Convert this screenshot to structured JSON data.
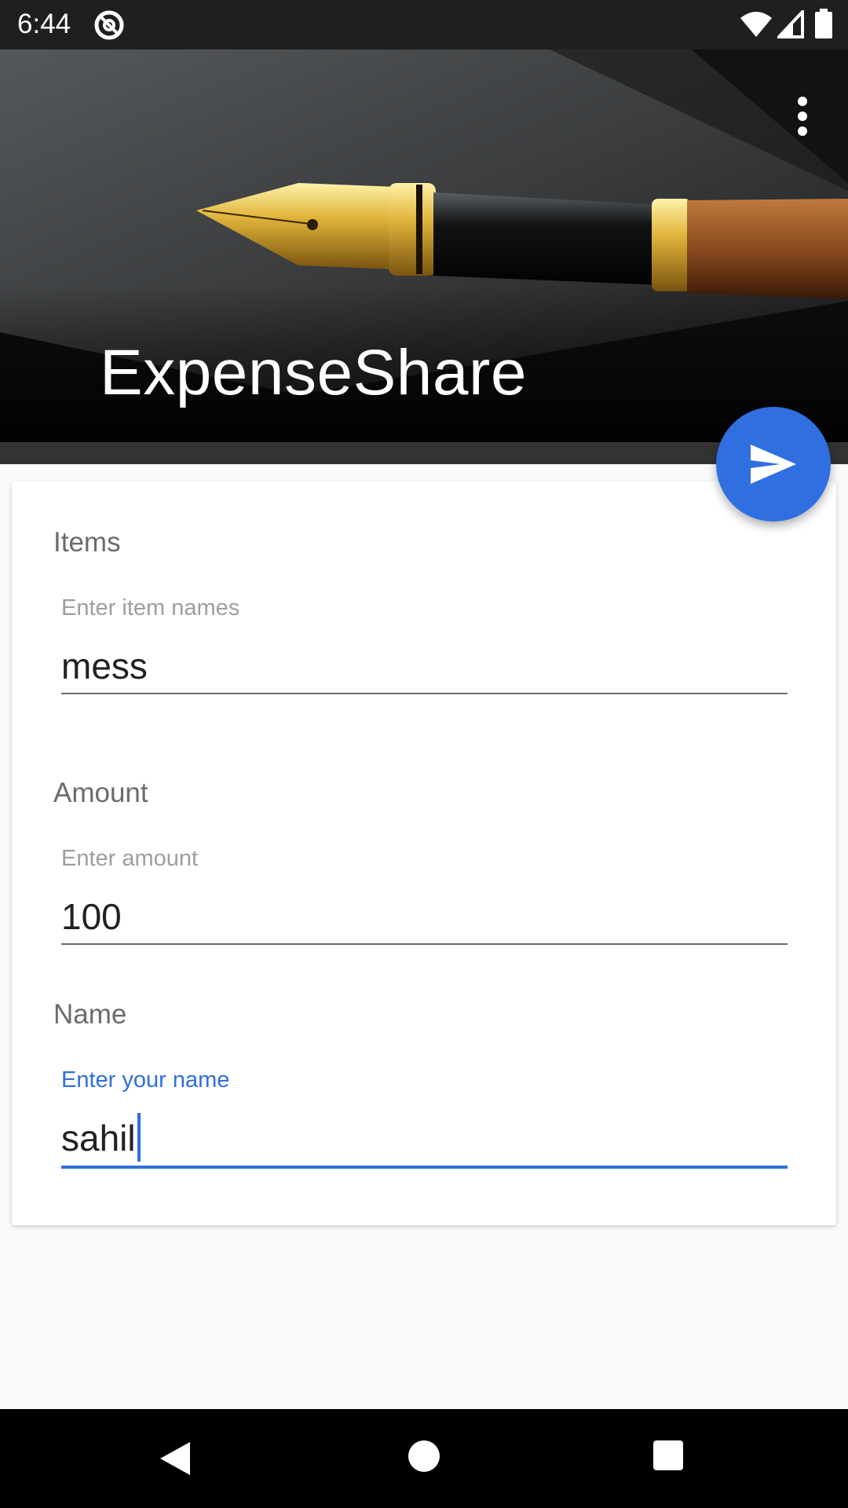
{
  "status_bar": {
    "time": "6:44",
    "icons": [
      "at-sign-icon",
      "wifi-icon",
      "signal-icon",
      "battery-icon"
    ]
  },
  "header": {
    "title": "ExpenseShare",
    "image": "fountain-pen-photo",
    "menu_icon": "overflow-menu-icon"
  },
  "fab": {
    "icon": "send-icon",
    "color": "#2f6fe0"
  },
  "form": {
    "items": {
      "section_label": "Items",
      "hint": "Enter item names",
      "value": "mess"
    },
    "amount": {
      "section_label": "Amount",
      "hint": "Enter amount",
      "value": "100"
    },
    "name": {
      "section_label": "Name",
      "hint": "Enter your name",
      "value": "sahil"
    }
  },
  "nav_bar": {
    "icons": [
      "back-icon",
      "home-icon",
      "recents-icon"
    ]
  },
  "colors": {
    "accent": "#2f6fe0",
    "status_bar": "#1f1f1f",
    "background": "#fafafa"
  }
}
